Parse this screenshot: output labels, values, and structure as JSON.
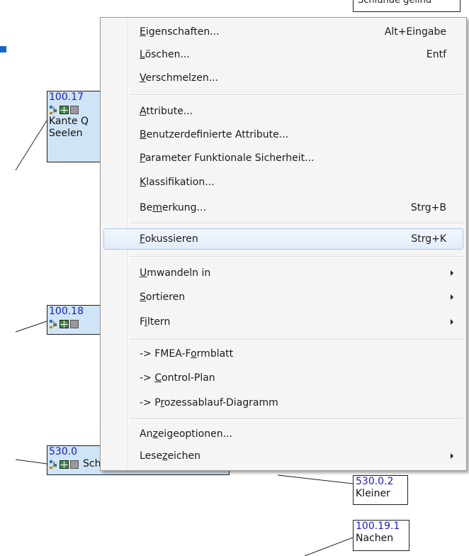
{
  "background": {
    "top_tag": "Schlünde gelind",
    "nodes": [
      {
        "id": "100.17",
        "line1": "Kante Q",
        "line2": "Seelen"
      },
      {
        "id": "100.18"
      },
      {
        "id": "530.0",
        "text": "Schale gut verloren"
      },
      {
        "id": "530.0.2",
        "text": "Kleiner"
      },
      {
        "id": "100.19.1",
        "text": "Nachen"
      }
    ]
  },
  "menu": {
    "items": [
      {
        "pre": "",
        "u": "E",
        "post": "igenschaften...",
        "shortcut": "Alt+Eingabe"
      },
      {
        "pre": "",
        "u": "L",
        "post": "öschen...",
        "shortcut": "Entf"
      },
      {
        "pre": "",
        "u": "V",
        "post": "erschmelzen...",
        "shortcut": ""
      },
      {
        "pre": "",
        "u": "A",
        "post": "ttribute...",
        "shortcut": ""
      },
      {
        "pre": "",
        "u": "B",
        "post": "enutzerdefinierte Attribute...",
        "shortcut": ""
      },
      {
        "pre": "",
        "u": "P",
        "post": "arameter Funktionale Sicherheit...",
        "shortcut": ""
      },
      {
        "pre": "",
        "u": "K",
        "post": "lassifikation...",
        "shortcut": ""
      },
      {
        "pre": "Be",
        "u": "m",
        "post": "erkung...",
        "shortcut": "Strg+B"
      },
      {
        "pre": "",
        "u": "F",
        "post": "okussieren",
        "shortcut": "Strg+K"
      },
      {
        "pre": "",
        "u": "U",
        "post": "mwandeln in",
        "shortcut": ""
      },
      {
        "pre": "",
        "u": "S",
        "post": "ortieren",
        "shortcut": ""
      },
      {
        "pre": "F",
        "u": "i",
        "post": "ltern",
        "shortcut": ""
      },
      {
        "pre": "-> FMEA-F",
        "u": "o",
        "post": "rmblatt",
        "shortcut": ""
      },
      {
        "pre": "-> ",
        "u": "C",
        "post": "ontrol-Plan",
        "shortcut": ""
      },
      {
        "pre": "-> P",
        "u": "r",
        "post": "ozessablauf-Diagramm",
        "shortcut": ""
      },
      {
        "pre": "An",
        "u": "z",
        "post": "eigeoptionen...",
        "shortcut": ""
      },
      {
        "pre": "Lese",
        "u": "z",
        "post": "eichen",
        "shortcut": ""
      }
    ]
  }
}
